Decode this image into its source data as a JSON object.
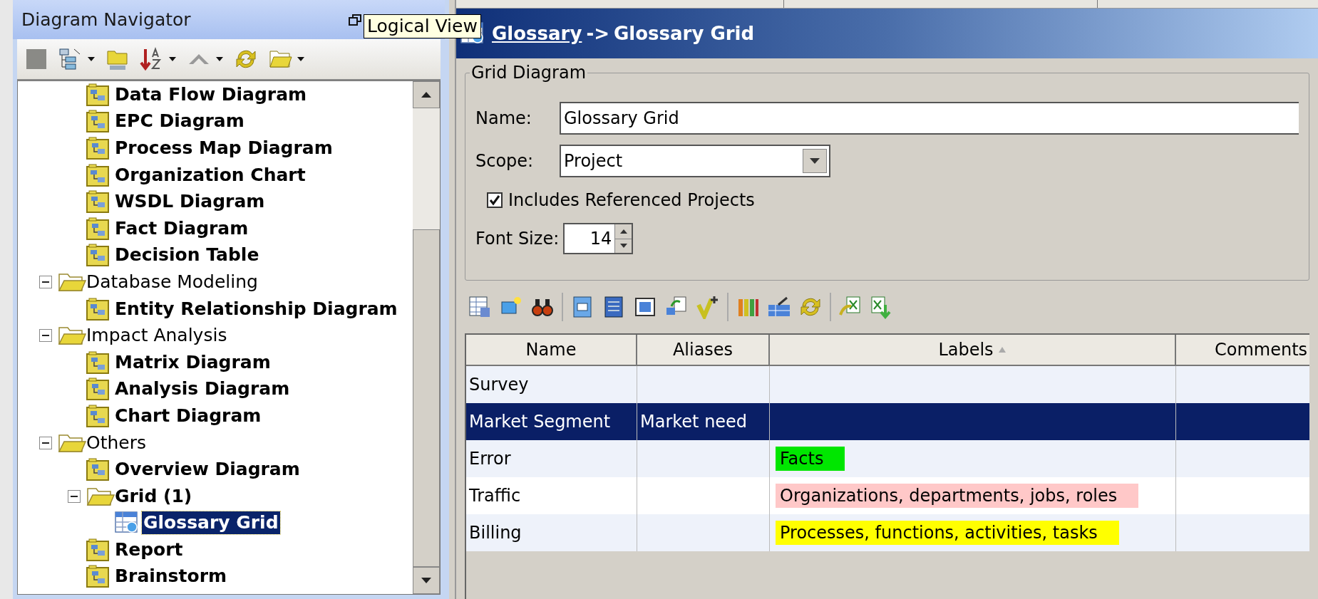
{
  "navigator": {
    "title": "Diagram Navigator",
    "tooltip": "Logical View"
  },
  "tree": {
    "continued": [
      {
        "label": "Data Flow Diagram",
        "kind": "diagram",
        "selected": false
      },
      {
        "label": "EPC Diagram",
        "kind": "diagram",
        "selected": false
      },
      {
        "label": "Process Map Diagram",
        "kind": "diagram",
        "selected": false
      },
      {
        "label": "Organization Chart",
        "kind": "diagram",
        "selected": false
      },
      {
        "label": "WSDL Diagram",
        "kind": "diagram",
        "selected": false
      },
      {
        "label": "Fact Diagram",
        "kind": "diagram",
        "selected": false
      },
      {
        "label": "Decision Table",
        "kind": "diagram",
        "selected": false
      }
    ],
    "nodes": [
      {
        "label": "Database Modeling",
        "kind": "category",
        "expanded": true,
        "selected": false,
        "children": [
          {
            "label": "Entity Relationship Diagram",
            "kind": "diagram",
            "selected": false
          }
        ]
      },
      {
        "label": "Impact Analysis",
        "kind": "category",
        "expanded": true,
        "selected": false,
        "children": [
          {
            "label": "Matrix Diagram",
            "kind": "diagram",
            "selected": false
          },
          {
            "label": "Analysis Diagram",
            "kind": "diagram",
            "selected": false
          },
          {
            "label": "Chart Diagram",
            "kind": "diagram",
            "selected": false
          }
        ]
      },
      {
        "label": "Others",
        "kind": "category",
        "expanded": true,
        "selected": false,
        "children": [
          {
            "label": "Overview Diagram",
            "kind": "diagram",
            "selected": false
          },
          {
            "label": "Grid (1)",
            "kind": "group",
            "expanded": true,
            "selected": false,
            "children": [
              {
                "label": "Glossary Grid",
                "kind": "grid",
                "selected": true
              }
            ]
          },
          {
            "label": "Report",
            "kind": "diagram",
            "selected": false
          },
          {
            "label": "Brainstorm",
            "kind": "diagram",
            "selected": false
          }
        ]
      }
    ]
  },
  "editor": {
    "breadcrumb_link": "Glossary",
    "breadcrumb_separator": "->",
    "breadcrumb_current": "Glossary Grid",
    "group_title": "Grid Diagram",
    "name": {
      "label": "Name:",
      "value": "Glossary Grid"
    },
    "scope": {
      "label": "Scope:",
      "value": "Project"
    },
    "includes_referenced": {
      "label": "Includes Referenced Projects",
      "checked": true
    },
    "font_size": {
      "label": "Font Size:",
      "value": "14"
    }
  },
  "table": {
    "columns": [
      {
        "label": "Name",
        "sorted": false
      },
      {
        "label": "Aliases",
        "sorted": false
      },
      {
        "label": "Labels",
        "sorted": true
      },
      {
        "label": "Comments",
        "sorted": false
      }
    ],
    "rows": [
      {
        "name": "Survey",
        "selected": false
      },
      {
        "name": "Market Segment",
        "aliases": "Market need",
        "selected": true
      },
      {
        "name": "Error",
        "labels": {
          "text": "Facts",
          "color": "#00e600"
        },
        "selected": false
      },
      {
        "name": "Traffic",
        "labels": {
          "text": "Organizations, departments, jobs, roles",
          "color": "#ffc8c8"
        },
        "selected": false
      },
      {
        "name": "Billing",
        "labels": {
          "text": "Processes, functions, activities, tasks",
          "color": "#ffff00"
        },
        "selected": false
      }
    ]
  }
}
